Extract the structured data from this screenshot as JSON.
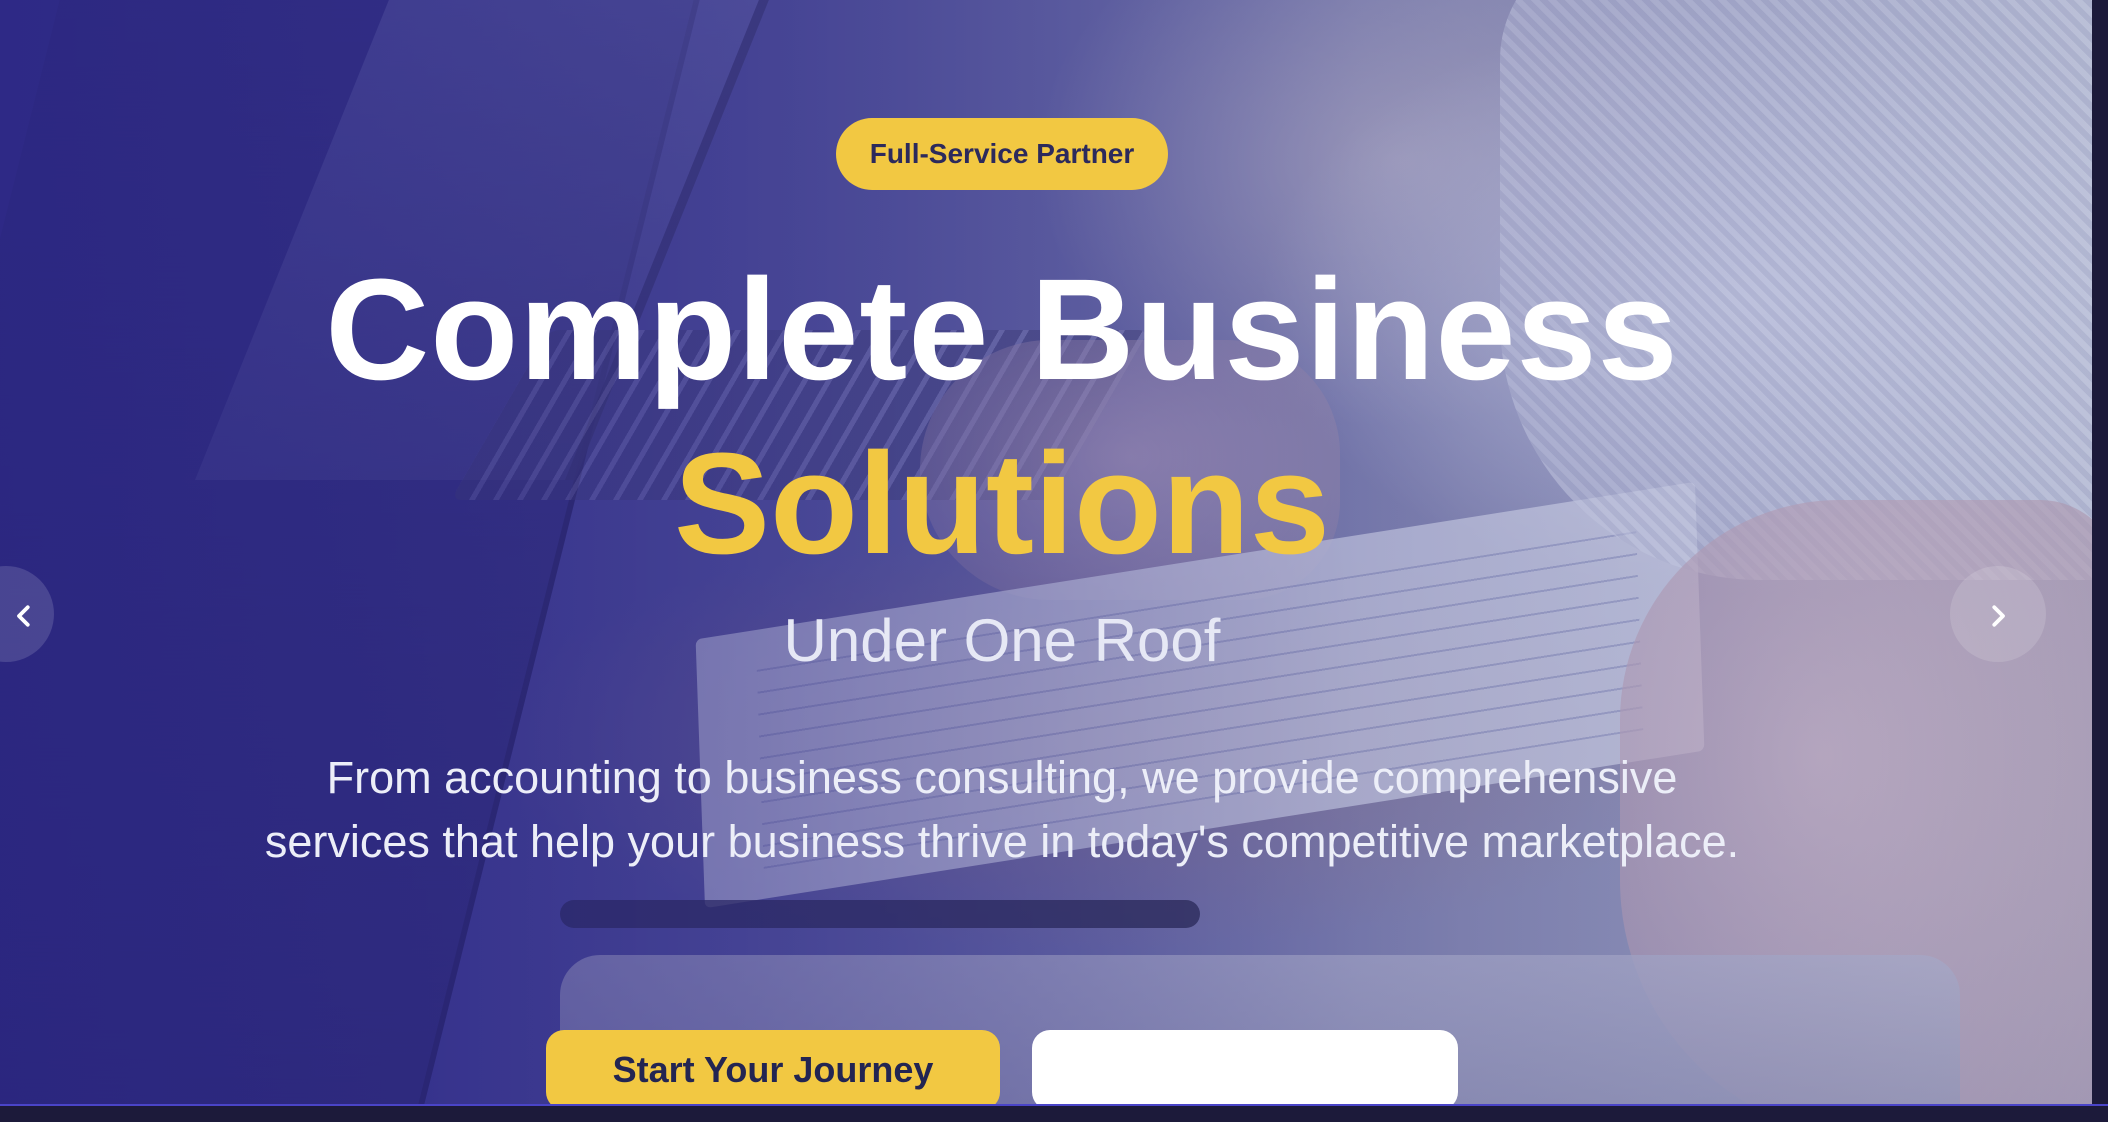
{
  "hero": {
    "badge": "Full-Service Partner",
    "title_line1": "Complete Business",
    "title_line2": "Solutions",
    "subtitle": "Under One Roof",
    "description": "From accounting to business consulting, we provide comprehensive services that help your business thrive in today's competitive marketplace.",
    "primary_cta": "Start Your Journey",
    "secondary_cta": ""
  },
  "carousel": {
    "prev_icon": "chevron-left-icon",
    "next_icon": "chevron-right-icon"
  },
  "colors": {
    "accent": "#f2c842",
    "overlay": "#2f2b82",
    "text": "#ffffff"
  }
}
